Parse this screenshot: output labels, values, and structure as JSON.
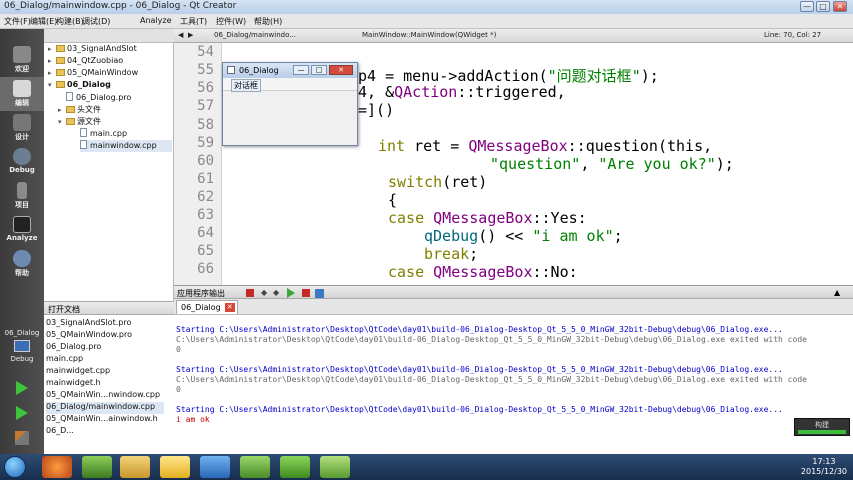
{
  "window": {
    "title": "06_Dialog/mainwindow.cpp - 06_Dialog - Qt Creator",
    "min": "—",
    "max": "□",
    "close": "✕"
  },
  "menubar": {
    "items": [
      "文件(F)",
      "编辑(E)",
      "构建(B)",
      "调试(D)",
      "Analyze",
      "工具(T)",
      "控件(W)",
      "帮助(H)"
    ]
  },
  "modes": {
    "welcome": "欢迎",
    "edit": "编辑",
    "design": "设计",
    "debug": "Debug",
    "projects": "项目",
    "analyze": "Analyze",
    "help": "帮助"
  },
  "kit": {
    "project": "06_Dialog",
    "mode": "Debug"
  },
  "tree": {
    "items": [
      "03_SignalAndSlot",
      "04_QtZuobiao",
      "05_QMainWindow",
      "06_Dialog",
      "06_Dialog.pro",
      "头文件",
      "源文件",
      "main.cpp",
      "mainwindow.cpp"
    ]
  },
  "opendocs": {
    "header": "打开文档",
    "items": [
      "03_SignalAndSlot.pro",
      "05_QMainWindow.pro",
      "06_Dialog.pro",
      "main.cpp",
      "mainwidget.cpp",
      "mainwidget.h",
      "05_QMainWin...nwindow.cpp",
      "06_Dialog/mainwindow.cpp",
      "05_QMainWin...ainwindow.h",
      "06_D..."
    ]
  },
  "editor_toolbar": {
    "file": "06_Dialog/mainwindo...",
    "symbol": "MainWindow::MainWindow(QWidget *)",
    "position": "Line: 70, Col: 27",
    "nav_back": "◀",
    "nav_fwd": "▶"
  },
  "editor": {
    "line_numbers": [
      "54",
      "55",
      "56",
      "57",
      "58",
      "59",
      "60",
      "61",
      "62",
      "63",
      "64",
      "65",
      "66"
    ],
    "lines": {
      "l54a": "p4 = menu->addAction(",
      "l54b": "\"问题对话框\"",
      "l54c": ");",
      "l55a": "4, &",
      "l55b": "QAction",
      "l55c": "::triggered,",
      "l56": "=](",
      "l56b": ")",
      "l58a": "int",
      "l58b": " ret = ",
      "l58c": "QMessageBox",
      "l58d": "::question(this,",
      "l59a": "\"question\"",
      "l59b": ", ",
      "l59c": "\"Are you ok?\"",
      "l59d": ");",
      "l60a": "switch",
      "l60b": "(ret)",
      "l61": "{",
      "l62a": "case ",
      "l62b": "QMessageBox",
      "l62c": "::Yes:",
      "l63a": "qDebug",
      "l63b": "() << ",
      "l63c": "\"i am ok\"",
      "l63d": ";",
      "l64a": "break",
      "l64b": ";",
      "l65a": "case ",
      "l65b": "QMessageBox",
      "l65c": "::No:"
    }
  },
  "dialog": {
    "title": "06_Dialog",
    "menu": "对话框",
    "min": "—",
    "max": "□",
    "close": "✕"
  },
  "output": {
    "header": "应用程序输出",
    "tab": "06_Dialog",
    "lines": [
      "Starting C:\\Users\\Administrator\\Desktop\\QtCode\\day01\\build-06_Dialog-Desktop_Qt_5_5_0_MinGW_32bit-Debug\\debug\\06_Dialog.exe...",
      "C:\\Users\\Administrator\\Desktop\\QtCode\\day01\\build-06_Dialog-Desktop_Qt_5_5_0_MinGW_32bit-Debug\\debug\\06_Dialog.exe exited with code",
      "0",
      "Starting C:\\Users\\Administrator\\Desktop\\QtCode\\day01\\build-06_Dialog-Desktop_Qt_5_5_0_MinGW_32bit-Debug\\debug\\06_Dialog.exe...",
      "C:\\Users\\Administrator\\Desktop\\QtCode\\day01\\build-06_Dialog-Desktop_Qt_5_5_0_MinGW_32bit-Debug\\debug\\06_Dialog.exe exited with code",
      "0",
      "Starting C:\\Users\\Administrator\\Desktop\\QtCode\\day01\\build-06_Dialog-Desktop_Qt_5_5_0_MinGW_32bit-Debug\\debug\\06_Dialog.exe...",
      "i am ok"
    ]
  },
  "build": {
    "label": "构建"
  },
  "taskbar": {
    "time": "17:13",
    "date": "2015/12/30"
  },
  "colors": {
    "accent": "#1c67b8",
    "keyword": "#808000",
    "class": "#800080",
    "string": "#008000"
  }
}
